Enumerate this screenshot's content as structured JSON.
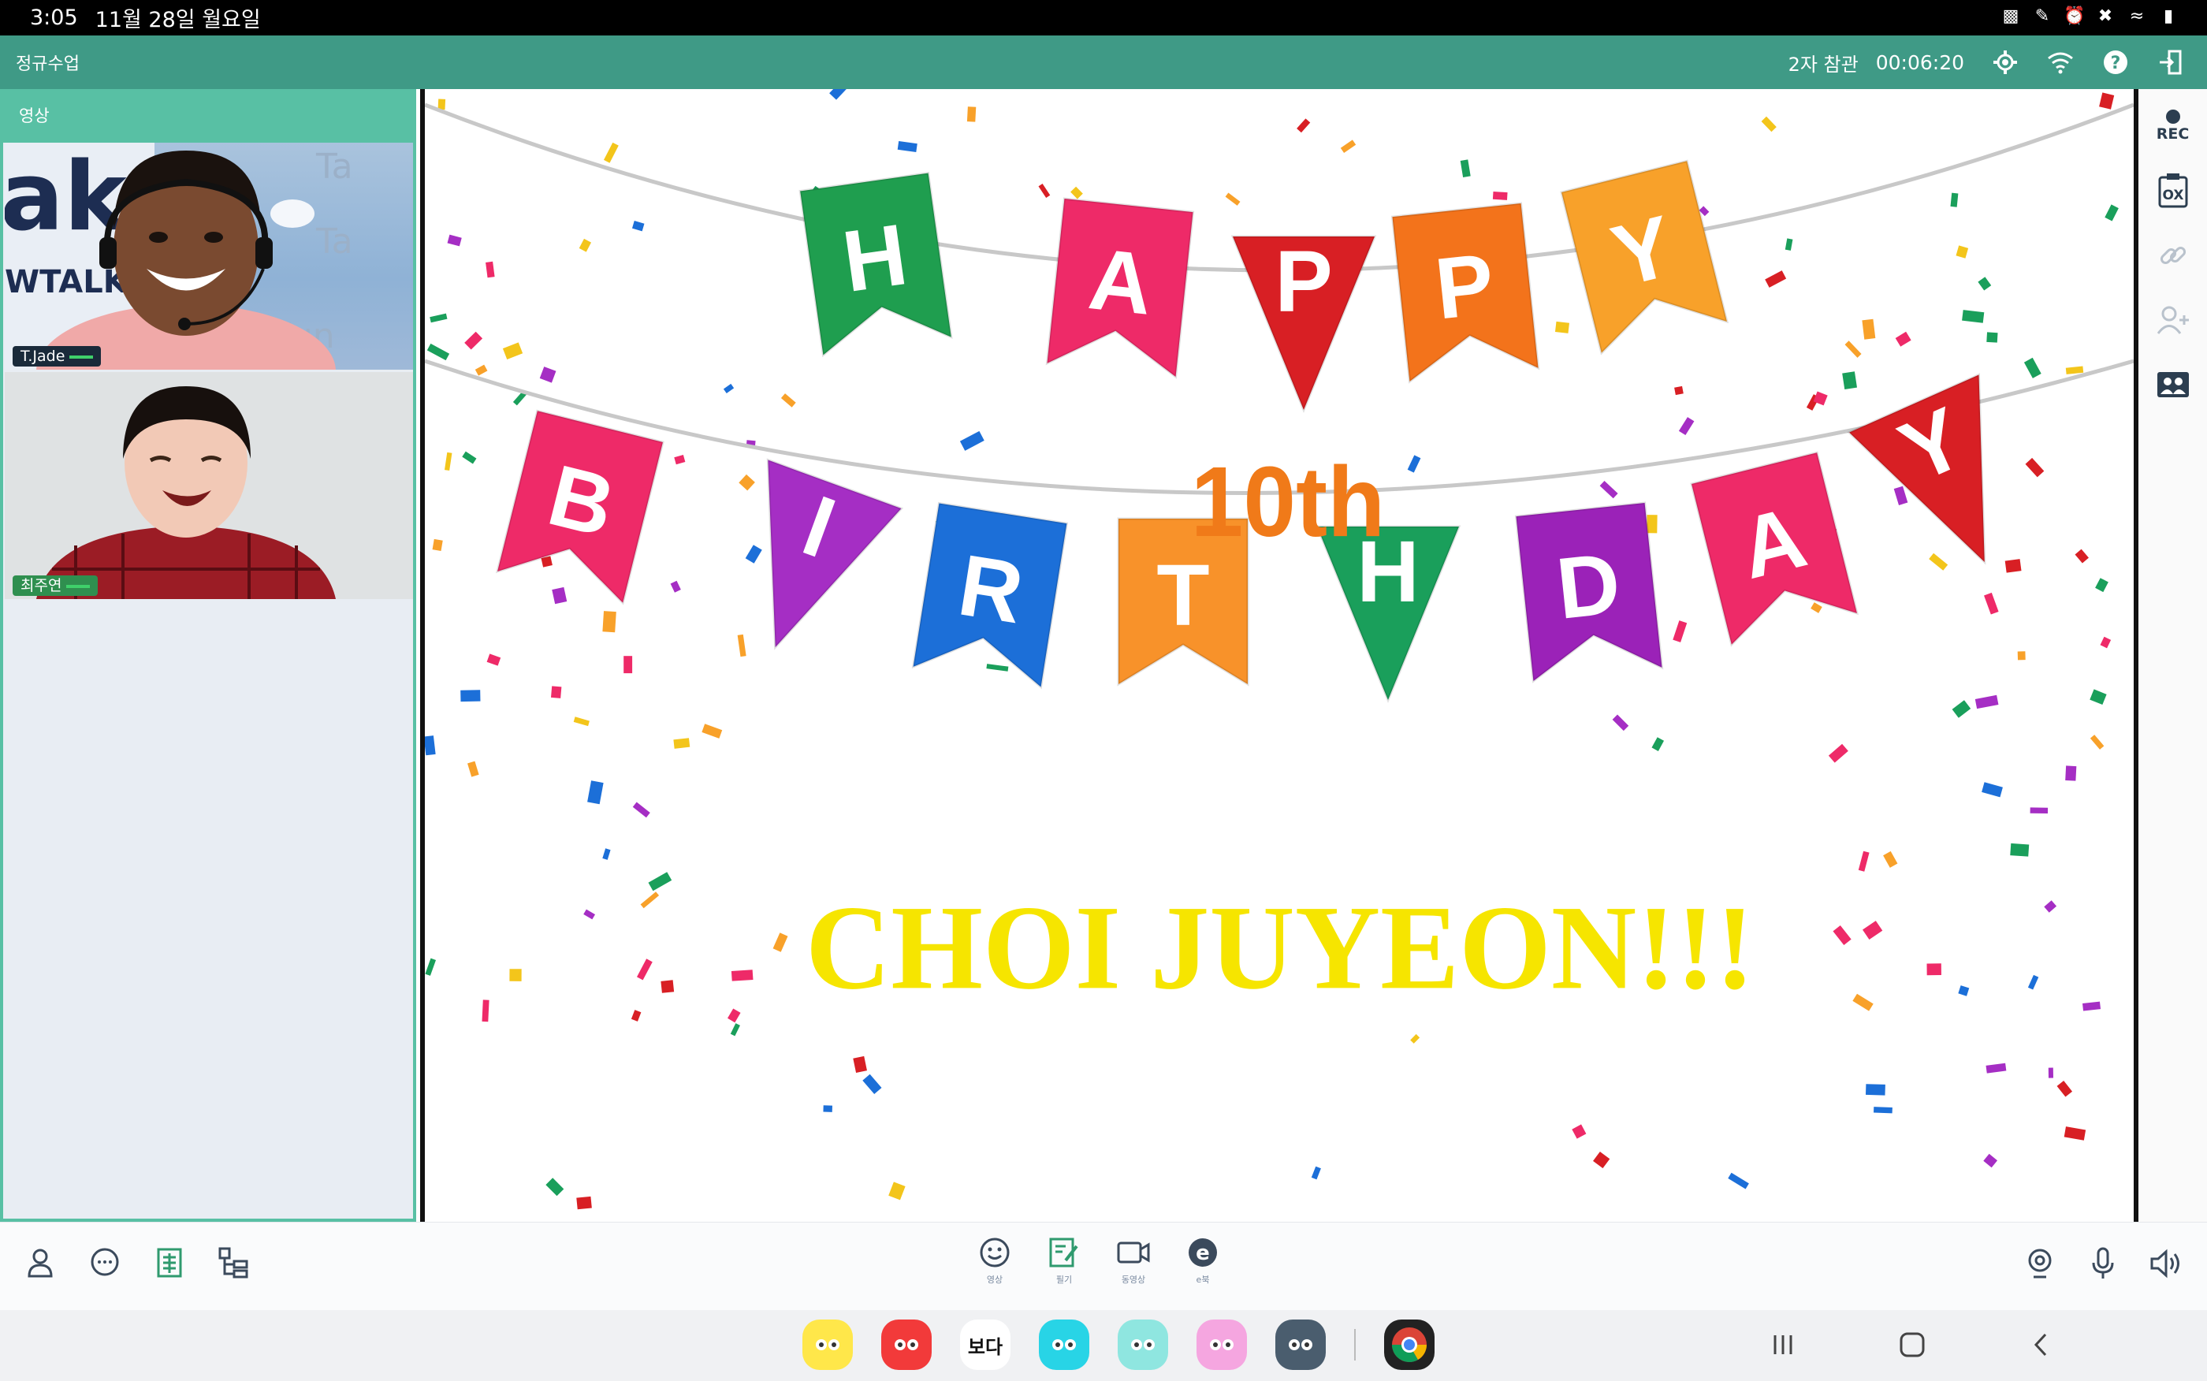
{
  "status_bar": {
    "time": "3:05",
    "date": "11월 28일 월요일",
    "icons": [
      "lock-icon",
      "pen-icon",
      "alarm-icon",
      "mute-icon",
      "wifi-icon",
      "battery-icon"
    ]
  },
  "app_bar": {
    "title": "정규수업",
    "participants": "2자 참관",
    "timer": "00:06:20",
    "icons": [
      "settings-icon",
      "wifi-icon",
      "help-icon",
      "exit-icon"
    ]
  },
  "video_panel": {
    "header": "영상",
    "tiles": [
      {
        "name": "T.Jade"
      },
      {
        "name": "최주연"
      }
    ]
  },
  "board": {
    "banner_top": [
      "H",
      "A",
      "P",
      "P",
      "Y"
    ],
    "banner_bottom": [
      "B",
      "I",
      "R",
      "T",
      "H",
      "D",
      "A",
      "Y"
    ],
    "age_text": "10th",
    "name_text": "CHOI JUYEON!!!",
    "colors": {
      "name": "#f6e500",
      "age": "#f07a19"
    }
  },
  "right_rail": {
    "rec_label": "REC",
    "items": [
      "rec-button",
      "ox-quiz-button",
      "link-button",
      "add-user-button",
      "screen-share-button"
    ]
  },
  "toolbar": {
    "left": [
      "participants-icon",
      "chat-icon",
      "document-icon",
      "layout-icon"
    ],
    "center": [
      {
        "name": "emoji-tool",
        "label": "영상"
      },
      {
        "name": "writing-tool",
        "label": "필기"
      },
      {
        "name": "video-tool",
        "label": "동영상"
      },
      {
        "name": "e-tool",
        "label": "e북"
      }
    ],
    "right": [
      "camera-icon",
      "mic-icon",
      "speaker-icon"
    ]
  },
  "dock": {
    "apps": [
      {
        "name": "app-yellow",
        "label": "",
        "color": "#ffe74a"
      },
      {
        "name": "app-red",
        "label": "",
        "color": "#f23a3a"
      },
      {
        "name": "app-boda",
        "label": "보다",
        "color": "#ffffff"
      },
      {
        "name": "app-cyan",
        "label": "",
        "color": "#28d4e6"
      },
      {
        "name": "app-mint",
        "label": "",
        "color": "#8fe6e0"
      },
      {
        "name": "app-pink",
        "label": "",
        "color": "#f5a6e0"
      },
      {
        "name": "app-grid",
        "label": "",
        "color": "#4a5d6e"
      },
      {
        "name": "app-chrome",
        "label": "",
        "color": "#222222"
      }
    ]
  }
}
